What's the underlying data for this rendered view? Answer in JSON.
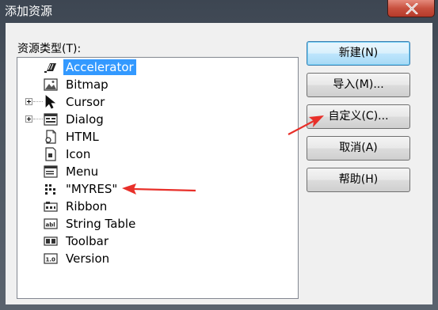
{
  "window": {
    "title": "添加资源"
  },
  "tree": {
    "label": "资源类型(T):",
    "items": [
      {
        "label": "Accelerator",
        "icon": "accelerator-icon",
        "expandable": false,
        "selected": true
      },
      {
        "label": "Bitmap",
        "icon": "bitmap-icon",
        "expandable": false,
        "selected": false
      },
      {
        "label": "Cursor",
        "icon": "cursor-icon",
        "expandable": true,
        "selected": false
      },
      {
        "label": "Dialog",
        "icon": "dialog-icon",
        "expandable": true,
        "selected": false
      },
      {
        "label": "HTML",
        "icon": "html-icon",
        "expandable": false,
        "selected": false
      },
      {
        "label": "Icon",
        "icon": "icon-resource-icon",
        "expandable": false,
        "selected": false
      },
      {
        "label": "Menu",
        "icon": "menu-icon",
        "expandable": false,
        "selected": false
      },
      {
        "label": "\"MYRES\"",
        "icon": "custom-resource-icon",
        "expandable": false,
        "selected": false
      },
      {
        "label": "Ribbon",
        "icon": "ribbon-icon",
        "expandable": false,
        "selected": false
      },
      {
        "label": "String Table",
        "icon": "string-table-icon",
        "expandable": false,
        "selected": false
      },
      {
        "label": "Toolbar",
        "icon": "toolbar-icon",
        "expandable": false,
        "selected": false
      },
      {
        "label": "Version",
        "icon": "version-icon",
        "expandable": false,
        "selected": false
      }
    ]
  },
  "buttons": {
    "new": "新建(N)",
    "import": "导入(M)...",
    "custom": "自定义(C)...",
    "cancel": "取消(A)",
    "help": "帮助(H)"
  },
  "colors": {
    "selection": "#3399ff",
    "annotation_arrow": "#e8302a"
  }
}
